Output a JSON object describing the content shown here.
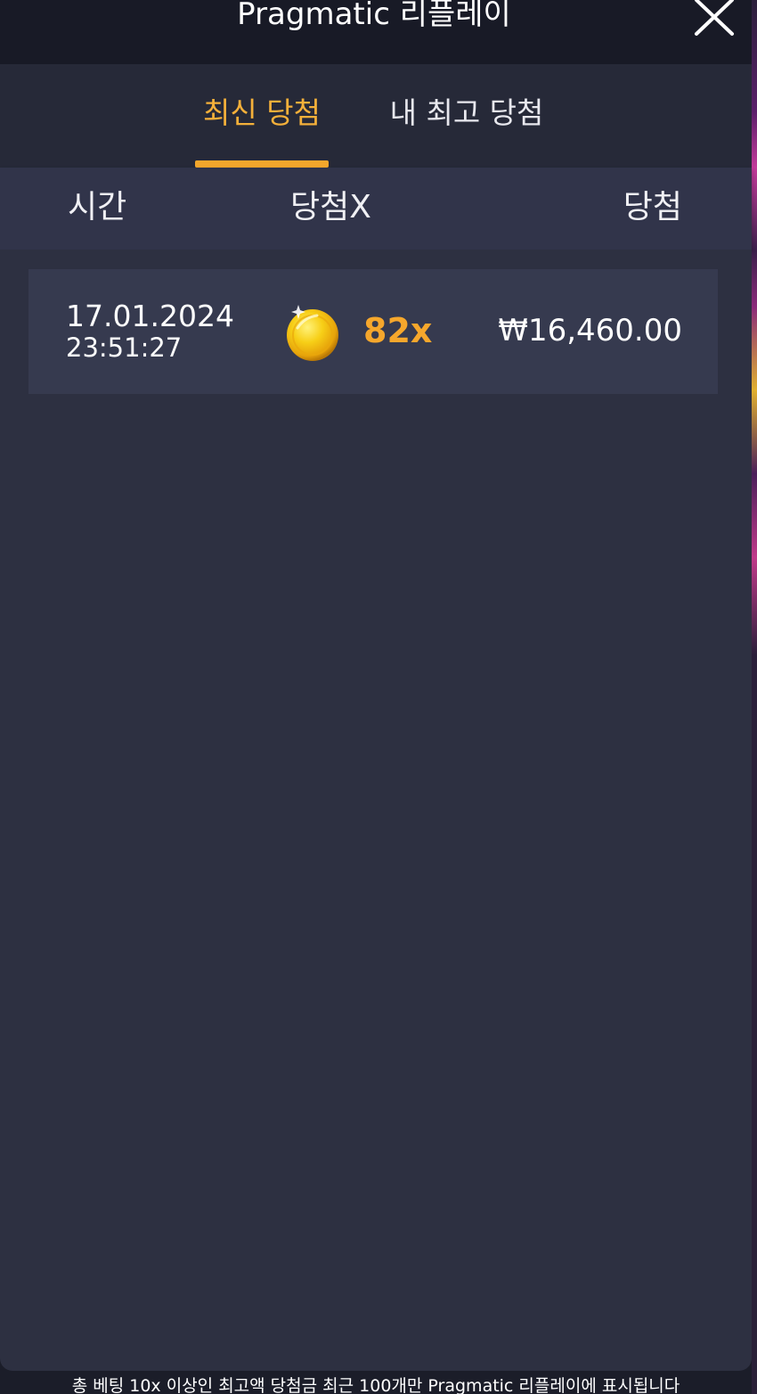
{
  "header": {
    "title": "Pragmatic 리플레이",
    "close_icon": "close-icon"
  },
  "tabs": [
    {
      "label": "최신 당첨",
      "active": true
    },
    {
      "label": "내 최고 당첨",
      "active": false
    }
  ],
  "table": {
    "columns": [
      "시간",
      "당첨X",
      "당첨"
    ],
    "rows": [
      {
        "date": "17.01.2024",
        "time": "23:51:27",
        "icon": "gold-coin-icon",
        "multiplier": "82x",
        "win": "₩16,460.00"
      }
    ]
  },
  "footer": {
    "note": "총 베팅 10x 이상인 최고액 당첨금 최근 100개만 Pragmatic 리플레이에 표시됩니다"
  },
  "colors": {
    "accent": "#f4a72c",
    "background": "#2d3041",
    "header": "#181a26"
  }
}
